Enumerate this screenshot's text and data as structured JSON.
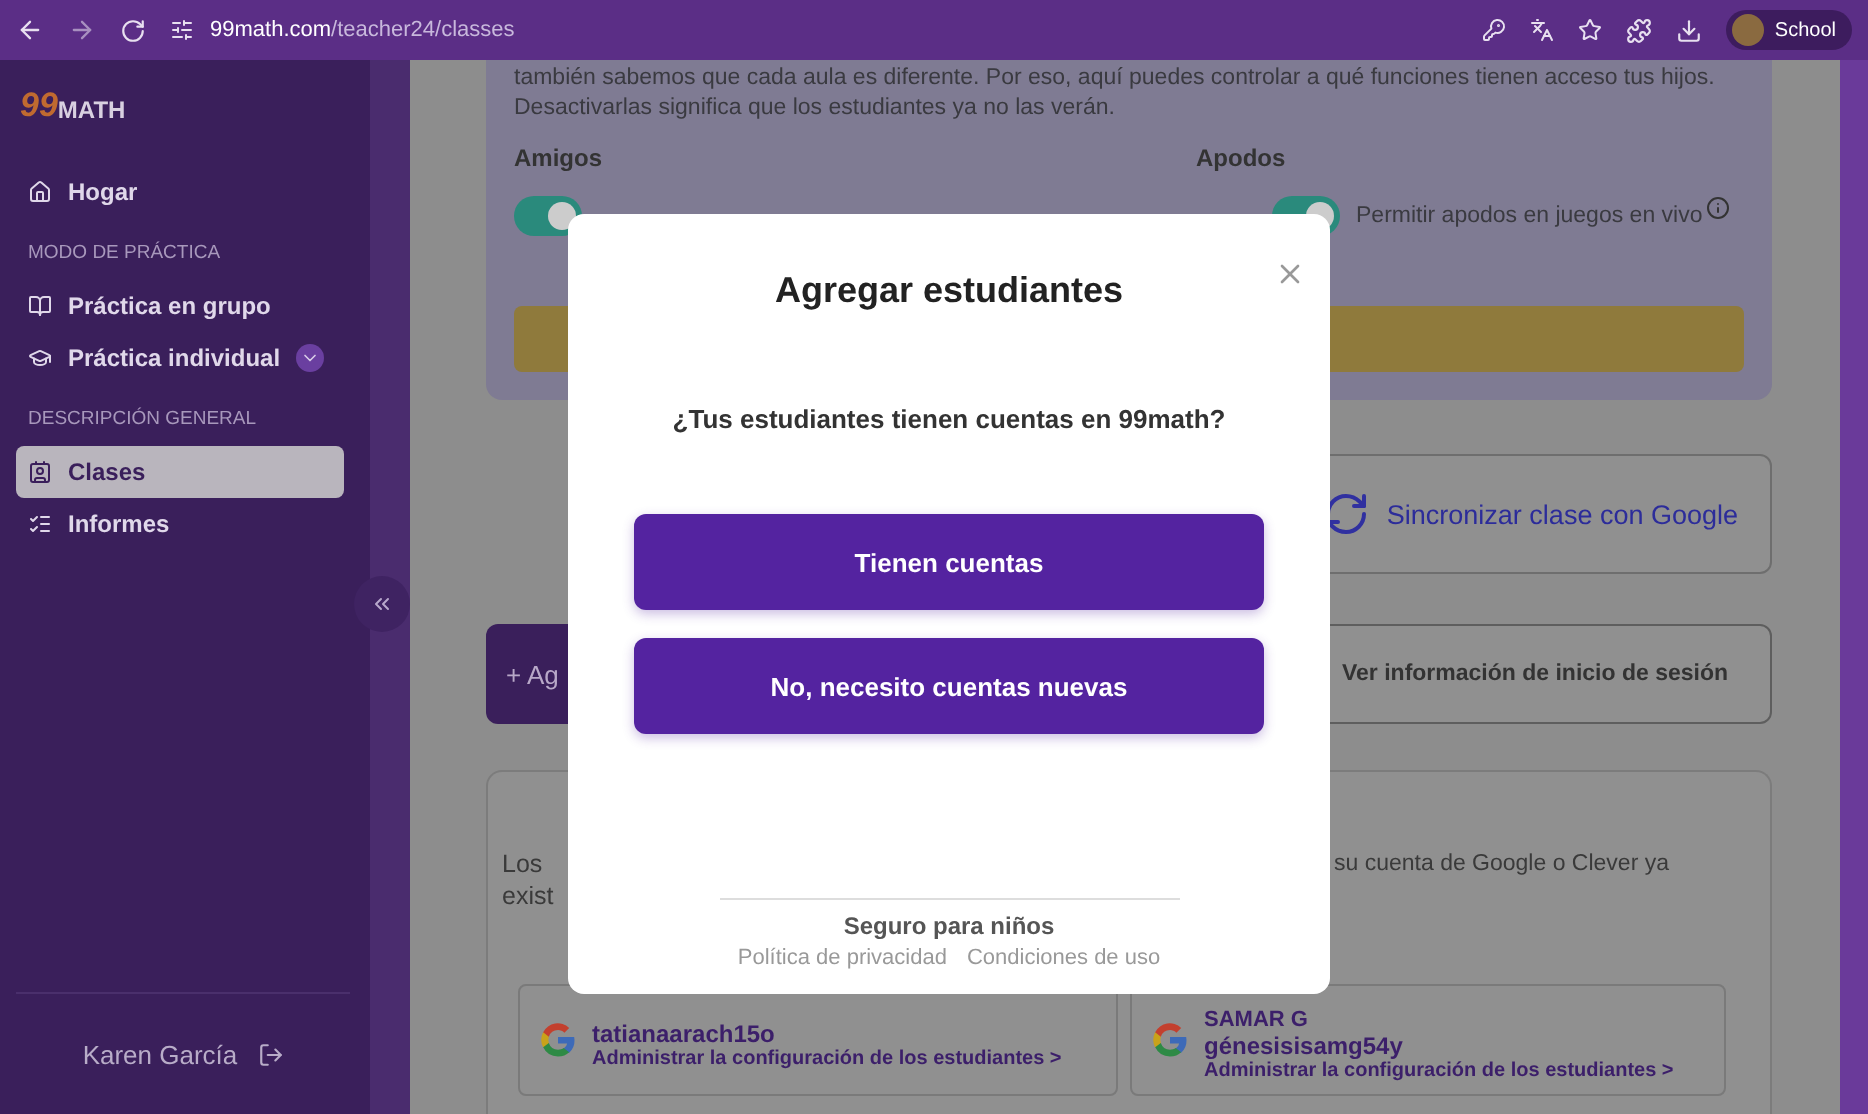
{
  "browser": {
    "url_domain": "99math.com",
    "url_path": "/teacher24/classes",
    "profile_label": "School"
  },
  "sidebar": {
    "logo": {
      "digits": "99",
      "word": "MATH"
    },
    "items": [
      {
        "kind": "link",
        "label": "Hogar",
        "selected": false
      },
      {
        "kind": "heading",
        "label": "MODO DE PRÁCTICA"
      },
      {
        "kind": "link",
        "label": "Práctica en grupo",
        "selected": false
      },
      {
        "kind": "link",
        "label": "Práctica individual",
        "selected": false,
        "expanded": false
      },
      {
        "kind": "heading",
        "label": "DESCRIPCIÓN GENERAL"
      },
      {
        "kind": "link",
        "label": "Clases",
        "selected": true
      },
      {
        "kind": "link",
        "label": "Informes",
        "selected": false
      }
    ],
    "user": "Karen García"
  },
  "settings_card": {
    "intro": [
      "también sabemos que cada aula es diferente. Por eso, aquí puedes controlar a qué funciones tienen acceso tus hijos.",
      "Desactivarlas significa que los estudiantes ya no las verán."
    ],
    "columns": [
      {
        "label": "Amigos",
        "on": true
      },
      {
        "label": "Apodos",
        "on": true,
        "option": "Permitir apodos en juegos en vivo"
      }
    ]
  },
  "sync_button": "Sincronizar clase con Google",
  "add_button": "+ Ag",
  "login_info_button": "Ver información de inicio de sesión",
  "students_card": {
    "text_left": [
      "Los",
      "exist"
    ],
    "text_right": "su cuenta de Google o Clever ya",
    "students": [
      {
        "username": "tatianaarach15o",
        "link": "Administrar la configuración de los estudiantes >"
      },
      {
        "name": "SAMAR G",
        "username": "génesisisamg54y",
        "link": "Administrar la configuración de los estudiantes >"
      }
    ]
  },
  "dialog": {
    "title": "Agregar estudiantes",
    "question": "¿Tus estudiantes tienen cuentas en 99math?",
    "options": [
      "Tienen cuentas",
      "No, necesito cuentas nuevas"
    ],
    "footer_title": "Seguro para niños",
    "footer_links": [
      "Política de privacidad",
      "Condiciones de uso"
    ]
  }
}
